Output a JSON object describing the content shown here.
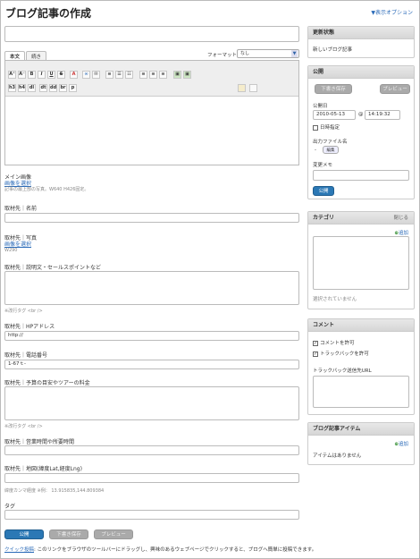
{
  "page": {
    "title": "ブログ記事の作成",
    "display_options": "▼表示オプション"
  },
  "editor": {
    "tabs": [
      {
        "label": "本文"
      },
      {
        "label": "続き"
      }
    ],
    "format_label": "フォーマット:",
    "format_value": "なし",
    "toolbar_row1": [
      "A⁺",
      "A⁻",
      "B",
      "I",
      "U",
      "S",
      "A",
      "∞",
      "✉",
      "≡",
      "☰",
      "☷",
      "≡",
      "≡",
      "≡",
      "▣",
      "▣"
    ],
    "toolbar_row2": [
      "h3",
      "h4",
      "dl",
      "dt",
      "dd",
      "br",
      "p"
    ]
  },
  "main_image": {
    "label": "メイン画像",
    "link": "画像を選択",
    "note": "記事の最上部の写真。W640 H426固定。"
  },
  "fields": {
    "name_label": "取材先｜名前",
    "photo_label": "取材先｜写真",
    "photo_link": "画像を選択",
    "photo_note": "W290",
    "desc_label": "取材先｜説明文・セールスポイントなど",
    "desc_note": "※改行タグ <br />",
    "hp_label": "取材先｜HPアドレス",
    "hp_value": "http://",
    "tel_label": "取材先｜電話番号",
    "tel_value": "1-67ｔ-",
    "budget_label": "取材先｜予算の目安やツアーの料金",
    "budget_note": "※改行タグ <br />",
    "hours_label": "取材先｜営業時間や所要時間",
    "map_label": "取材先｜地図(緯度Lat,経度Lng)",
    "map_note": "緯度カンマ経度 ※例： 13.915835,144.809384",
    "tags_label": "タグ"
  },
  "bottom_buttons": {
    "publish": "公開",
    "draft": "下書き保存",
    "preview": "プレビュー"
  },
  "footer": {
    "link": "クイック投稿",
    "text": ": このリンクをブラウザのツールバーにドラッグし、興味のあるウェブページでクリックすると、ブログへ簡単に投稿できます。"
  },
  "sidebar": {
    "status": {
      "title": "更新状態",
      "value": "新しいブログ記事"
    },
    "publish": {
      "title": "公開",
      "draft_button": "下書き保存",
      "preview_button": "プレビュー",
      "date_label": "公開日",
      "date_value": "2010-05-13",
      "at": "@",
      "time_value": "14:19:32",
      "time_check_label": "日時指定",
      "file_label": "出力ファイル名",
      "file_dash": "-",
      "file_edit": "編集",
      "memo_label": "変更メモ",
      "publish_button": "公開"
    },
    "category": {
      "title": "カテゴリ",
      "close": "閉じる",
      "add": "追加",
      "empty": "選択されていません"
    },
    "comment": {
      "title": "コメント",
      "allow_comments": "コメントを許可",
      "allow_trackbacks": "トラックバックを許可",
      "trackback_url_label": "トラックバック送信先URL"
    },
    "items": {
      "title": "ブログ記事アイテム",
      "add": "追加",
      "empty": "アイテムはありません"
    }
  }
}
